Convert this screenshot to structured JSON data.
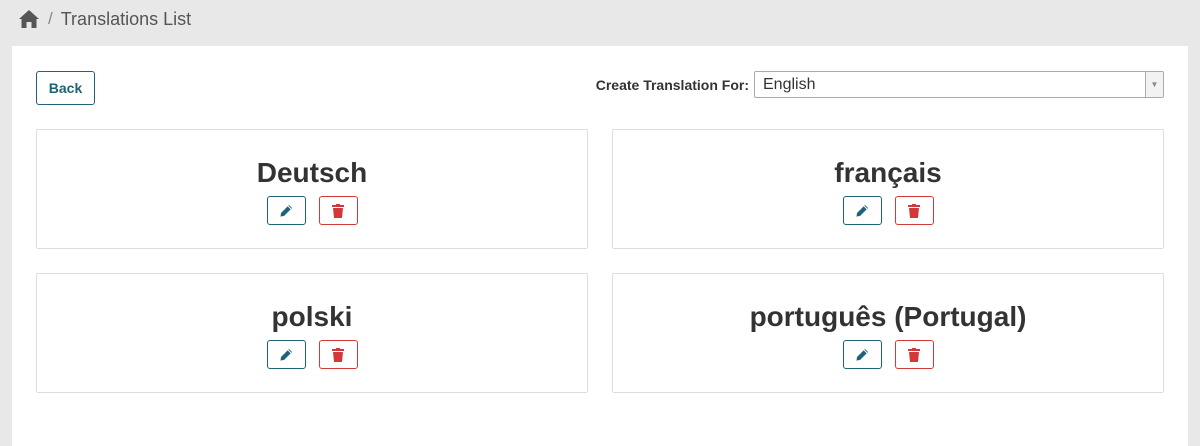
{
  "breadcrumb": {
    "home_icon": "home-icon",
    "separator": "/",
    "current": "Translations List"
  },
  "toolbar": {
    "back_label": "Back",
    "create_label": "Create Translation For:",
    "create_selected": "English"
  },
  "colors": {
    "primary": "#1e6379",
    "danger": "#d23a3a",
    "background": "#e8e8e8"
  },
  "translations": [
    {
      "name": "Deutsch",
      "edit_icon": "pencil-icon",
      "delete_icon": "trash-icon"
    },
    {
      "name": "français",
      "edit_icon": "pencil-icon",
      "delete_icon": "trash-icon"
    },
    {
      "name": "polski",
      "edit_icon": "pencil-icon",
      "delete_icon": "trash-icon"
    },
    {
      "name": "português (Portugal)",
      "edit_icon": "pencil-icon",
      "delete_icon": "trash-icon"
    }
  ]
}
